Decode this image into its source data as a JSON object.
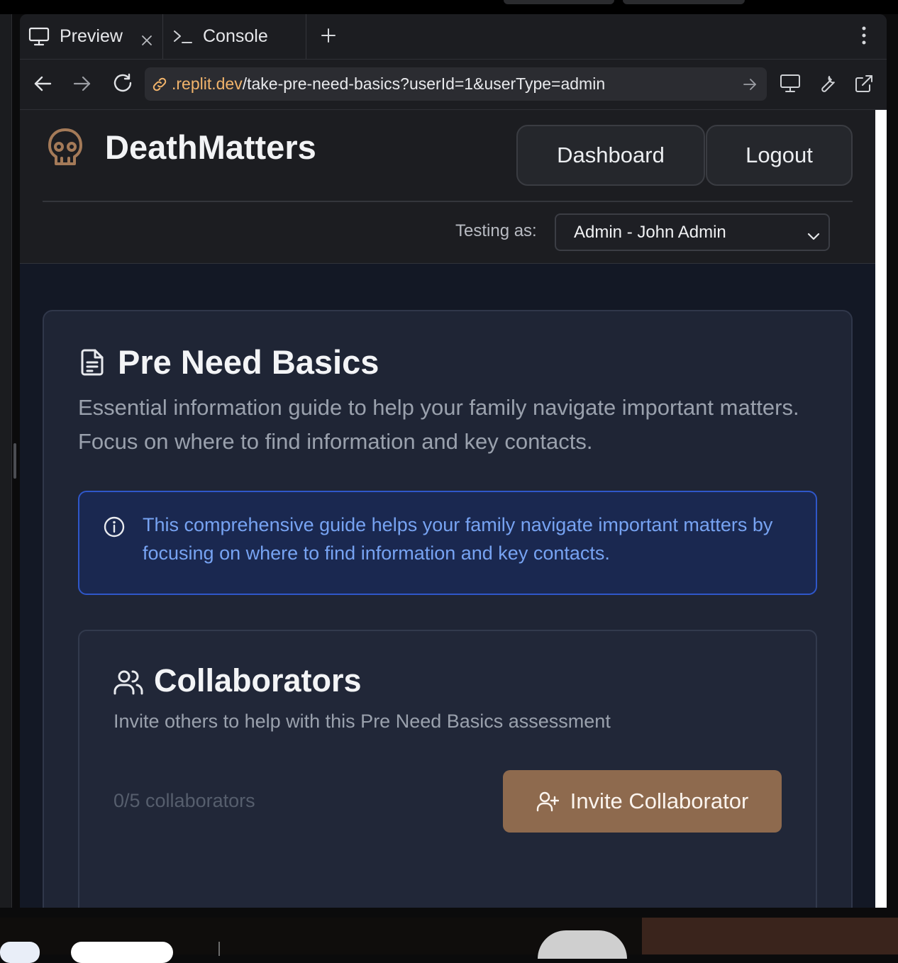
{
  "browser": {
    "tabs": [
      {
        "label": "Preview",
        "icon": "monitor-icon",
        "active": true
      },
      {
        "label": "Console",
        "icon": "terminal-icon",
        "active": false
      }
    ],
    "url": {
      "host": ".replit.dev",
      "path": "/take-pre-need-basics?userId=1&userType=admin"
    }
  },
  "header": {
    "brand": "DeathMatters",
    "logo_icon": "skull-icon",
    "buttons": {
      "dashboard": "Dashboard",
      "logout": "Logout"
    },
    "testing_label": "Testing as:",
    "testing_value": "Admin - John Admin"
  },
  "main": {
    "title": "Pre Need Basics",
    "title_icon": "document-icon",
    "description": "Essential information guide to help your family navigate important matters. Focus on where to find information and key contacts.",
    "info": "This comprehensive guide helps your family navigate important matters by focusing on where to find information and key contacts.",
    "collaborators": {
      "title": "Collaborators",
      "description": "Invite others to help with this Pre Need Basics assessment",
      "count": "0/5 collaborators",
      "invite_label": "Invite Collaborator"
    }
  },
  "colors": {
    "accent_brown": "#8e6a4e",
    "info_blue": "#77a3f2",
    "url_host": "#f2b46b",
    "page_bg": "#131825"
  }
}
